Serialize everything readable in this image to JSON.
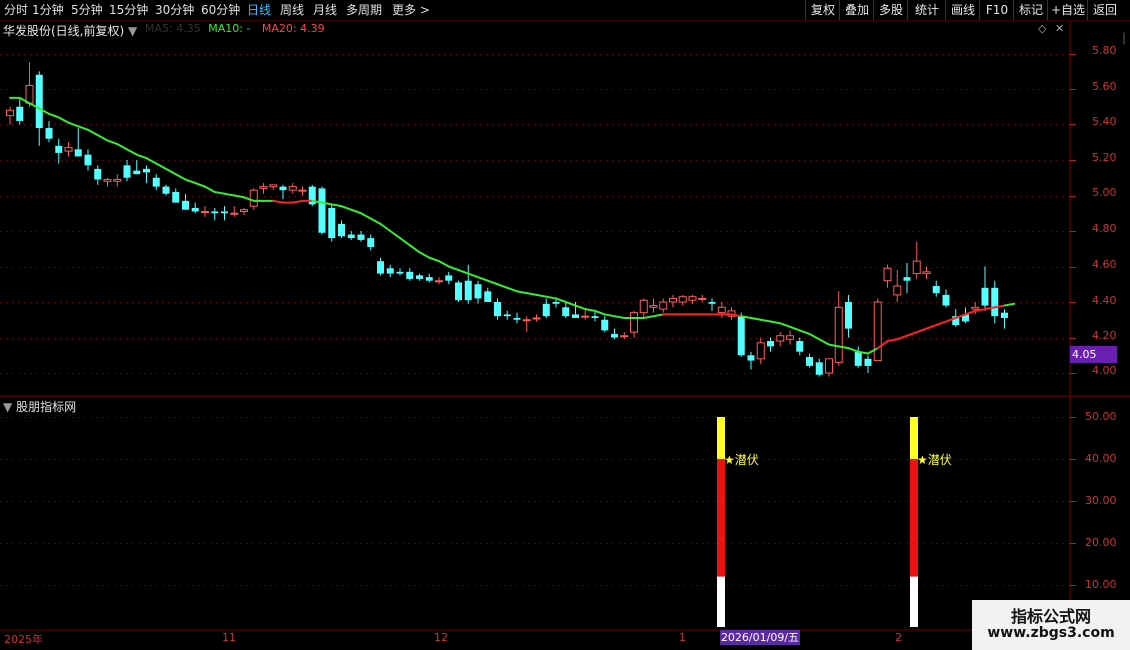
{
  "topbar": {
    "periods": [
      "分时",
      "1分钟",
      "5分钟",
      "15分钟",
      "30分钟",
      "60分钟",
      "日线",
      "周线",
      "月线",
      "多周期",
      "更多 >"
    ],
    "active_index": 6,
    "buttons": [
      "复权",
      "叠加",
      "多股",
      "统计",
      "画线",
      "F10",
      "标记",
      "+自选",
      "返回"
    ]
  },
  "main": {
    "title": "华发股份(日线,前复权)",
    "ma5_label": "MA5: 4.35",
    "ma10_label": "MA10: -",
    "ma20_label": "MA20: 4.39",
    "price_axis": [
      "5.80",
      "5.60",
      "5.40",
      "5.20",
      "5.00",
      "4.80",
      "4.60",
      "4.40",
      "4.20",
      "4.00"
    ],
    "current_price": "4.05"
  },
  "indicator": {
    "name": "股朋指标网",
    "axis": [
      "50.00",
      "40.00",
      "30.00",
      "20.00",
      "10.00"
    ],
    "signal_label": "★潜伏"
  },
  "date_axis": {
    "labels": [
      "2025年",
      "11",
      "12",
      "1",
      "2"
    ],
    "cursor_date": "2026/01/09/五"
  },
  "watermark": {
    "line1": "指标公式网",
    "line2": "www.zbgs3.com"
  },
  "colors": {
    "up": "#ff5b5b",
    "down": "#54ffff",
    "ma": "#33ee33",
    "ma_red": "#ff2222",
    "grid": "#5a0000"
  },
  "chart_data": {
    "type": "candlestick",
    "ylim": [
      3.95,
      5.85
    ],
    "candles": [
      [
        5.45,
        5.5,
        5.4,
        5.48
      ],
      [
        5.5,
        5.55,
        5.4,
        5.42
      ],
      [
        5.52,
        5.75,
        5.5,
        5.62
      ],
      [
        5.68,
        5.7,
        5.28,
        5.38
      ],
      [
        5.38,
        5.42,
        5.3,
        5.32
      ],
      [
        5.28,
        5.32,
        5.18,
        5.24
      ],
      [
        5.25,
        5.3,
        5.22,
        5.27
      ],
      [
        5.26,
        5.38,
        5.24,
        5.22
      ],
      [
        5.23,
        5.26,
        5.14,
        5.17
      ],
      [
        5.15,
        5.17,
        5.06,
        5.09
      ],
      [
        5.08,
        5.1,
        5.05,
        5.09
      ],
      [
        5.08,
        5.12,
        5.05,
        5.09
      ],
      [
        5.17,
        5.2,
        5.08,
        5.1
      ],
      [
        5.14,
        5.2,
        5.12,
        5.12
      ],
      [
        5.15,
        5.17,
        5.07,
        5.13
      ],
      [
        5.1,
        5.12,
        5.03,
        5.05
      ],
      [
        5.05,
        5.06,
        5.0,
        5.01
      ],
      [
        5.02,
        5.04,
        4.96,
        4.96
      ],
      [
        4.97,
        5.01,
        4.92,
        4.92
      ],
      [
        4.93,
        4.96,
        4.9,
        4.91
      ],
      [
        4.91,
        4.94,
        4.88,
        4.91
      ],
      [
        4.91,
        4.93,
        4.86,
        4.9
      ],
      [
        4.91,
        4.94,
        4.86,
        4.9
      ],
      [
        4.9,
        4.94,
        4.88,
        4.9
      ],
      [
        4.91,
        4.93,
        4.89,
        4.92
      ],
      [
        4.94,
        5.04,
        4.92,
        5.03
      ],
      [
        5.04,
        5.07,
        5.01,
        5.05
      ],
      [
        5.05,
        5.06,
        5.03,
        5.06
      ],
      [
        5.05,
        5.06,
        4.98,
        5.03
      ],
      [
        5.03,
        5.07,
        5.01,
        5.05
      ],
      [
        5.03,
        5.05,
        5.0,
        5.03
      ],
      [
        5.05,
        5.06,
        4.94,
        4.95
      ],
      [
        5.04,
        5.05,
        4.78,
        4.79
      ],
      [
        4.93,
        4.95,
        4.74,
        4.76
      ],
      [
        4.84,
        4.86,
        4.76,
        4.77
      ],
      [
        4.78,
        4.8,
        4.75,
        4.76
      ],
      [
        4.78,
        4.8,
        4.74,
        4.75
      ],
      [
        4.76,
        4.78,
        4.69,
        4.71
      ],
      [
        4.63,
        4.65,
        4.55,
        4.56
      ],
      [
        4.59,
        4.61,
        4.54,
        4.56
      ],
      [
        4.57,
        4.59,
        4.55,
        4.56
      ],
      [
        4.57,
        4.59,
        4.52,
        4.53
      ],
      [
        4.55,
        4.56,
        4.52,
        4.53
      ],
      [
        4.54,
        4.56,
        4.51,
        4.52
      ],
      [
        4.52,
        4.54,
        4.5,
        4.52
      ],
      [
        4.55,
        4.57,
        4.5,
        4.52
      ],
      [
        4.51,
        4.52,
        4.4,
        4.41
      ],
      [
        4.52,
        4.61,
        4.39,
        4.41
      ],
      [
        4.5,
        4.52,
        4.39,
        4.42
      ],
      [
        4.46,
        4.48,
        4.4,
        4.4
      ],
      [
        4.4,
        4.42,
        4.3,
        4.32
      ],
      [
        4.33,
        4.35,
        4.3,
        4.32
      ],
      [
        4.31,
        4.34,
        4.28,
        4.3
      ],
      [
        4.3,
        4.32,
        4.23,
        4.3
      ],
      [
        4.31,
        4.33,
        4.29,
        4.31
      ],
      [
        4.39,
        4.42,
        4.31,
        4.32
      ],
      [
        4.4,
        4.42,
        4.37,
        4.39
      ],
      [
        4.37,
        4.4,
        4.31,
        4.32
      ],
      [
        4.33,
        4.4,
        4.31,
        4.31
      ],
      [
        4.32,
        4.36,
        4.3,
        4.32
      ],
      [
        4.32,
        4.35,
        4.29,
        4.31
      ],
      [
        4.3,
        4.32,
        4.23,
        4.24
      ],
      [
        4.22,
        4.25,
        4.19,
        4.2
      ],
      [
        4.21,
        4.23,
        4.19,
        4.21
      ],
      [
        4.23,
        4.35,
        4.2,
        4.34
      ],
      [
        4.34,
        4.42,
        4.31,
        4.41
      ],
      [
        4.37,
        4.42,
        4.34,
        4.38
      ],
      [
        4.36,
        4.42,
        4.34,
        4.4
      ],
      [
        4.4,
        4.44,
        4.37,
        4.42
      ],
      [
        4.4,
        4.44,
        4.38,
        4.43
      ],
      [
        4.41,
        4.44,
        4.39,
        4.43
      ],
      [
        4.42,
        4.44,
        4.4,
        4.42
      ],
      [
        4.4,
        4.42,
        4.35,
        4.39
      ],
      [
        4.34,
        4.4,
        4.31,
        4.37
      ],
      [
        4.32,
        4.37,
        4.3,
        4.35
      ],
      [
        4.32,
        4.34,
        4.09,
        4.1
      ],
      [
        4.1,
        4.12,
        4.02,
        4.07
      ],
      [
        4.08,
        4.2,
        4.05,
        4.17
      ],
      [
        4.18,
        4.2,
        4.12,
        4.15
      ],
      [
        4.18,
        4.23,
        4.15,
        4.21
      ],
      [
        4.19,
        4.24,
        4.16,
        4.21
      ],
      [
        4.18,
        4.2,
        4.1,
        4.12
      ],
      [
        4.09,
        4.11,
        4.03,
        4.04
      ],
      [
        4.06,
        4.08,
        3.98,
        3.99
      ],
      [
        4.0,
        4.08,
        3.98,
        4.08
      ],
      [
        4.06,
        4.46,
        4.04,
        4.37
      ],
      [
        4.4,
        4.44,
        4.2,
        4.25
      ],
      [
        4.12,
        4.15,
        4.03,
        4.04
      ],
      [
        4.08,
        4.1,
        4.0,
        4.04
      ],
      [
        4.07,
        4.42,
        4.07,
        4.4
      ],
      [
        4.52,
        4.61,
        4.48,
        4.59
      ],
      [
        4.44,
        4.58,
        4.4,
        4.49
      ],
      [
        4.54,
        4.62,
        4.45,
        4.52
      ],
      [
        4.56,
        4.74,
        4.53,
        4.63
      ],
      [
        4.56,
        4.6,
        4.53,
        4.57
      ],
      [
        4.49,
        4.52,
        4.43,
        4.45
      ],
      [
        4.44,
        4.47,
        4.37,
        4.38
      ],
      [
        4.32,
        4.36,
        4.26,
        4.27
      ],
      [
        4.33,
        4.37,
        4.28,
        4.29
      ],
      [
        4.36,
        4.4,
        4.33,
        4.37
      ],
      [
        4.48,
        4.6,
        4.35,
        4.38
      ],
      [
        4.48,
        4.52,
        4.28,
        4.32
      ],
      [
        4.34,
        4.36,
        4.25,
        4.31
      ]
    ],
    "ma": [
      5.55,
      5.55,
      5.52,
      5.49,
      5.46,
      5.44,
      5.41,
      5.39,
      5.37,
      5.34,
      5.31,
      5.29,
      5.26,
      5.23,
      5.21,
      5.18,
      5.15,
      5.12,
      5.09,
      5.07,
      5.05,
      5.02,
      5.01,
      5.0,
      4.99,
      4.97,
      4.97,
      4.97,
      4.96,
      4.96,
      4.97,
      4.97,
      4.96,
      4.95,
      4.94,
      4.92,
      4.9,
      4.87,
      4.84,
      4.8,
      4.76,
      4.72,
      4.68,
      4.65,
      4.63,
      4.6,
      4.58,
      4.56,
      4.54,
      4.52,
      4.5,
      4.48,
      4.46,
      4.45,
      4.44,
      4.43,
      4.42,
      4.4,
      4.38,
      4.36,
      4.35,
      4.33,
      4.32,
      4.31,
      4.31,
      4.31,
      4.32,
      4.33,
      4.33,
      4.33,
      4.33,
      4.33,
      4.33,
      4.33,
      4.33,
      4.32,
      4.31,
      4.3,
      4.29,
      4.28,
      4.26,
      4.24,
      4.22,
      4.19,
      4.16,
      4.15,
      4.14,
      4.12,
      4.11,
      4.14,
      4.18,
      4.19,
      4.21,
      4.23,
      4.25,
      4.27,
      4.29,
      4.31,
      4.33,
      4.35,
      4.36,
      4.37,
      4.38,
      4.39
    ],
    "ma_red_segments": [
      [
        27,
        31
      ],
      [
        67,
        75
      ],
      [
        89,
        102
      ]
    ],
    "signals": [
      {
        "x": 81,
        "yellow": [
          40,
          50
        ],
        "red": [
          12,
          40
        ],
        "white": [
          0,
          12
        ]
      },
      {
        "x": 102,
        "yellow": [
          40,
          50
        ],
        "red": [
          12,
          40
        ],
        "white": [
          0,
          12
        ]
      }
    ]
  }
}
